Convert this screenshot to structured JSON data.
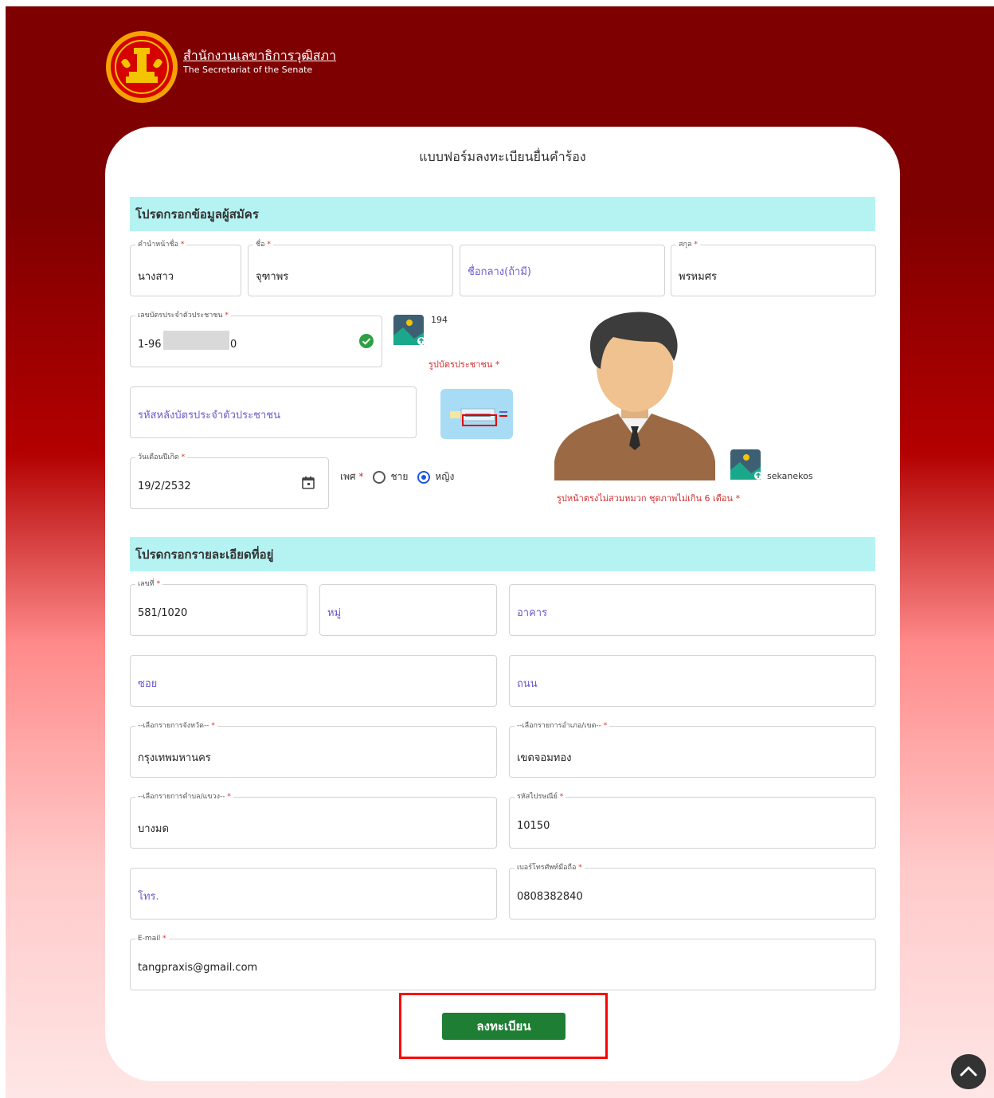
{
  "header": {
    "org_name_th": "สำนักงานเลขาธิการวุฒิสภา",
    "org_name_en": "The Secretariat of the Senate"
  },
  "form": {
    "title": "แบบฟอร์มลงทะเบียนยื่นคำร้อง",
    "section_applicant": "โปรดกรอกข้อมูลผู้สมัคร",
    "section_address": "โปรดกรอกรายละเอียดที่อยู่",
    "required_mark": "*"
  },
  "applicant": {
    "prefix": {
      "label": "คำนำหน้าชื่อ",
      "value": "นางสาว"
    },
    "first_name": {
      "label": "ชื่อ",
      "value": "จุฑาพร"
    },
    "middle_name": {
      "placeholder": "ชื่อกลาง(ถ้ามี)"
    },
    "last_name": {
      "label": "สกุล",
      "value": "พรหมศร"
    },
    "id_card": {
      "label": "เลขบัตรประจำตัวประชาชน",
      "value_start": "1-96",
      "value_end": "0"
    },
    "id_card_upload_count": "194",
    "id_card_photo_label": "รูปบัตรประชาชน",
    "back_code": {
      "placeholder": "รหัสหลังบัตรประจำตัวประชาชน"
    },
    "birth_date": {
      "label": "วันเดือนปีเกิด",
      "value": "19/2/2532"
    },
    "gender": {
      "label": "เพศ",
      "option_male": "ชาย",
      "option_female": "หญิง",
      "selected": "หญิง"
    },
    "photo_filename": "sekanekos",
    "photo_note": "รูปหน้าตรงไม่สวมหมวก ชุดภาพไม่เกิน 6 เดือน"
  },
  "address": {
    "house_no": {
      "label": "เลขที่",
      "value": "581/1020"
    },
    "moo": {
      "placeholder": "หมู่"
    },
    "building": {
      "placeholder": "อาคาร"
    },
    "soi": {
      "placeholder": "ซอย"
    },
    "road": {
      "placeholder": "ถนน"
    },
    "province": {
      "label": "--เลือกรายการจังหวัด--",
      "value": "กรุงเทพมหานคร"
    },
    "district": {
      "label": "--เลือกรายการอำเภอ/เขต--",
      "value": "เขตจอมทอง"
    },
    "subdistrict": {
      "label": "--เลือกรายการตำบล/แขวง--",
      "value": "บางมด"
    },
    "postal_code": {
      "label": "รหัสไปรษณีย์",
      "value": "10150"
    },
    "phone": {
      "placeholder": "โทร."
    },
    "mobile": {
      "label": "เบอร์โทรศัพท์มือถือ",
      "value": "0808382840"
    },
    "email": {
      "label": "E-mail",
      "value": "tangpraxis@gmail.com"
    }
  },
  "actions": {
    "submit_label": "ลงทะเบียน"
  },
  "colors": {
    "header_bg": "#7e0000",
    "section_bg": "#b5f3f3",
    "submit_bg": "#1e7e34",
    "highlight": "#ff0000"
  }
}
